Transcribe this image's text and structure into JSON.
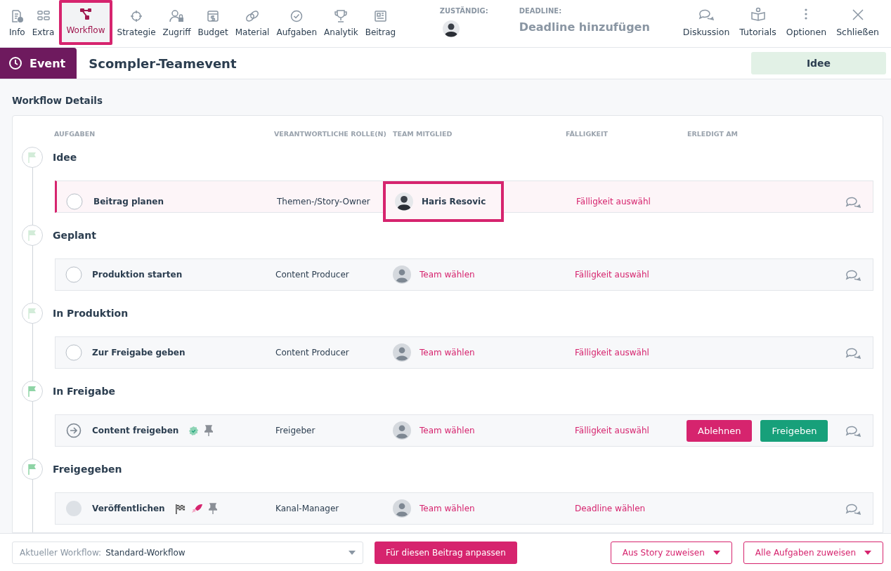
{
  "nav": [
    {
      "label": "Info",
      "selected": false
    },
    {
      "label": "Extra",
      "selected": false
    },
    {
      "label": "Workflow",
      "selected": true
    },
    {
      "label": "Strategie",
      "selected": false
    },
    {
      "label": "Zugriff",
      "selected": false
    },
    {
      "label": "Budget",
      "selected": false
    },
    {
      "label": "Material",
      "selected": false
    },
    {
      "label": "Aufgaben",
      "selected": false
    },
    {
      "label": "Analytik",
      "selected": false
    },
    {
      "label": "Beitrag",
      "selected": false
    }
  ],
  "assignee": {
    "label": "ZUSTÄNDIG:"
  },
  "deadline": {
    "label": "DEADLINE:",
    "placeholder": "Deadline hinzufügen"
  },
  "actions": [
    {
      "label": "Diskussion"
    },
    {
      "label": "Tutorials"
    },
    {
      "label": "Optionen"
    },
    {
      "label": "Schließen"
    }
  ],
  "header": {
    "type": "Event",
    "title": "Scompler-Teamevent",
    "status": "Idee"
  },
  "section_title": "Workflow Details",
  "columns": [
    "AUFGABEN",
    "VERANTWORTLICHE ROLLE(N)",
    "TEAM MITGLIED",
    "FÄLLIGKEIT",
    "ERLEDIGT AM"
  ],
  "stages": [
    {
      "name": "Idee",
      "color": "#d3ecd9",
      "tasks": [
        {
          "kind": "open",
          "name": "Beitrag planen",
          "role": "Themen-/Story-Owner",
          "member": {
            "kind": "person",
            "name": "Haris Resovic",
            "highlighted": true
          },
          "due": "Fälligkeit auswähl",
          "highlighted": true
        }
      ]
    },
    {
      "name": "Geplant",
      "color": "#d3ecd9",
      "tasks": [
        {
          "kind": "open",
          "name": "Produktion starten",
          "role": "Content Producer",
          "member": {
            "kind": "placeholder",
            "name": "Team wählen",
            "highlighted": false
          },
          "due": "Fälligkeit auswähl",
          "highlighted": false
        }
      ]
    },
    {
      "name": "In Produktion",
      "color": "#d3ecd9",
      "tasks": [
        {
          "kind": "open",
          "name": "Zur Freigabe geben",
          "role": "Content Producer",
          "member": {
            "kind": "placeholder",
            "name": "Team wählen",
            "highlighted": false
          },
          "due": "Fälligkeit auswähl",
          "highlighted": false
        }
      ]
    },
    {
      "name": "In Freigabe",
      "color": "#8fd4a6",
      "tasks": [
        {
          "kind": "forward",
          "name": "Content freigeben",
          "verified": true,
          "pinned": true,
          "role": "Freigeber",
          "member": {
            "kind": "placeholder",
            "name": "Team wählen",
            "highlighted": false
          },
          "due": "Fälligkeit auswähl",
          "highlighted": false,
          "buttons": [
            {
              "kind": "reject",
              "label": "Ablehnen"
            },
            {
              "kind": "approve",
              "label": "Freigeben"
            }
          ]
        }
      ]
    },
    {
      "name": "Freigegeben",
      "color": "#8fd4a6",
      "tasks": [
        {
          "kind": "locked",
          "name": "Veröffentlichen",
          "finish_flag": true,
          "rocket": true,
          "pinned": true,
          "role": "Kanal-Manager",
          "member": {
            "kind": "placeholder",
            "name": "Team wählen",
            "highlighted": false
          },
          "due": "Deadline wählen",
          "highlighted": false
        }
      ]
    }
  ],
  "footer": {
    "workflow_label": "Aktueller Workflow:",
    "workflow_value": "Standard-Workflow",
    "customize": "Für diesen Beitrag anpassen",
    "assign_story": "Aus Story zuweisen",
    "assign_all": "Alle Aufgaben zuweisen"
  }
}
